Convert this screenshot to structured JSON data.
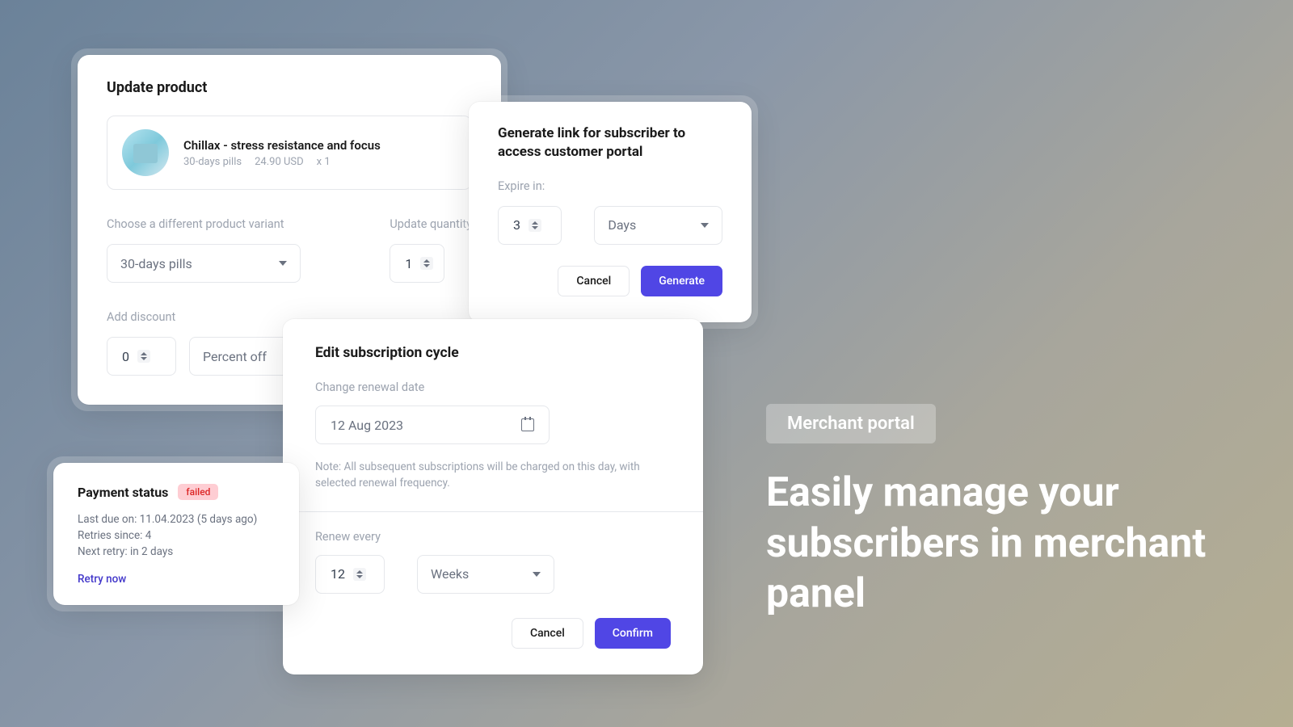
{
  "updateProduct": {
    "title": "Update product",
    "productName": "Chillax - stress resistance and focus",
    "variantMeta": "30-days pills",
    "priceMeta": "24.90 USD",
    "qtyMeta": "x 1",
    "chooseVariantLabel": "Choose a different product variant",
    "updateQuantityLabel": "Update quantity",
    "variantValue": "30-days pills",
    "quantityValue": "1",
    "addDiscountLabel": "Add discount",
    "discountValue": "0",
    "discountType": "Percent off"
  },
  "generateLink": {
    "title": "Generate link for subscriber to access customer portal",
    "expireLabel": "Expire in:",
    "expireValue": "3",
    "expireUnit": "Days",
    "cancel": "Cancel",
    "generate": "Generate"
  },
  "editSubscription": {
    "title": "Edit subscription cycle",
    "changeDateLabel": "Change renewal date",
    "dateValue": "12 Aug 2023",
    "note": "Note: All subsequent subscriptions will be charged on this day, with selected renewal frequency.",
    "renewEveryLabel": "Renew every",
    "renewValue": "12",
    "renewUnit": "Weeks",
    "cancel": "Cancel",
    "confirm": "Confirm"
  },
  "paymentStatus": {
    "title": "Payment status",
    "badge": "failed",
    "lastDue": "Last due on: 11.04.2023 (5 days ago)",
    "retriesSince": "Retries since: 4",
    "nextRetry": "Next retry: in 2 days",
    "retryNow": "Retry now"
  },
  "marketing": {
    "pill": "Merchant portal",
    "headline": "Easily manage your subscribers in merchant panel"
  }
}
